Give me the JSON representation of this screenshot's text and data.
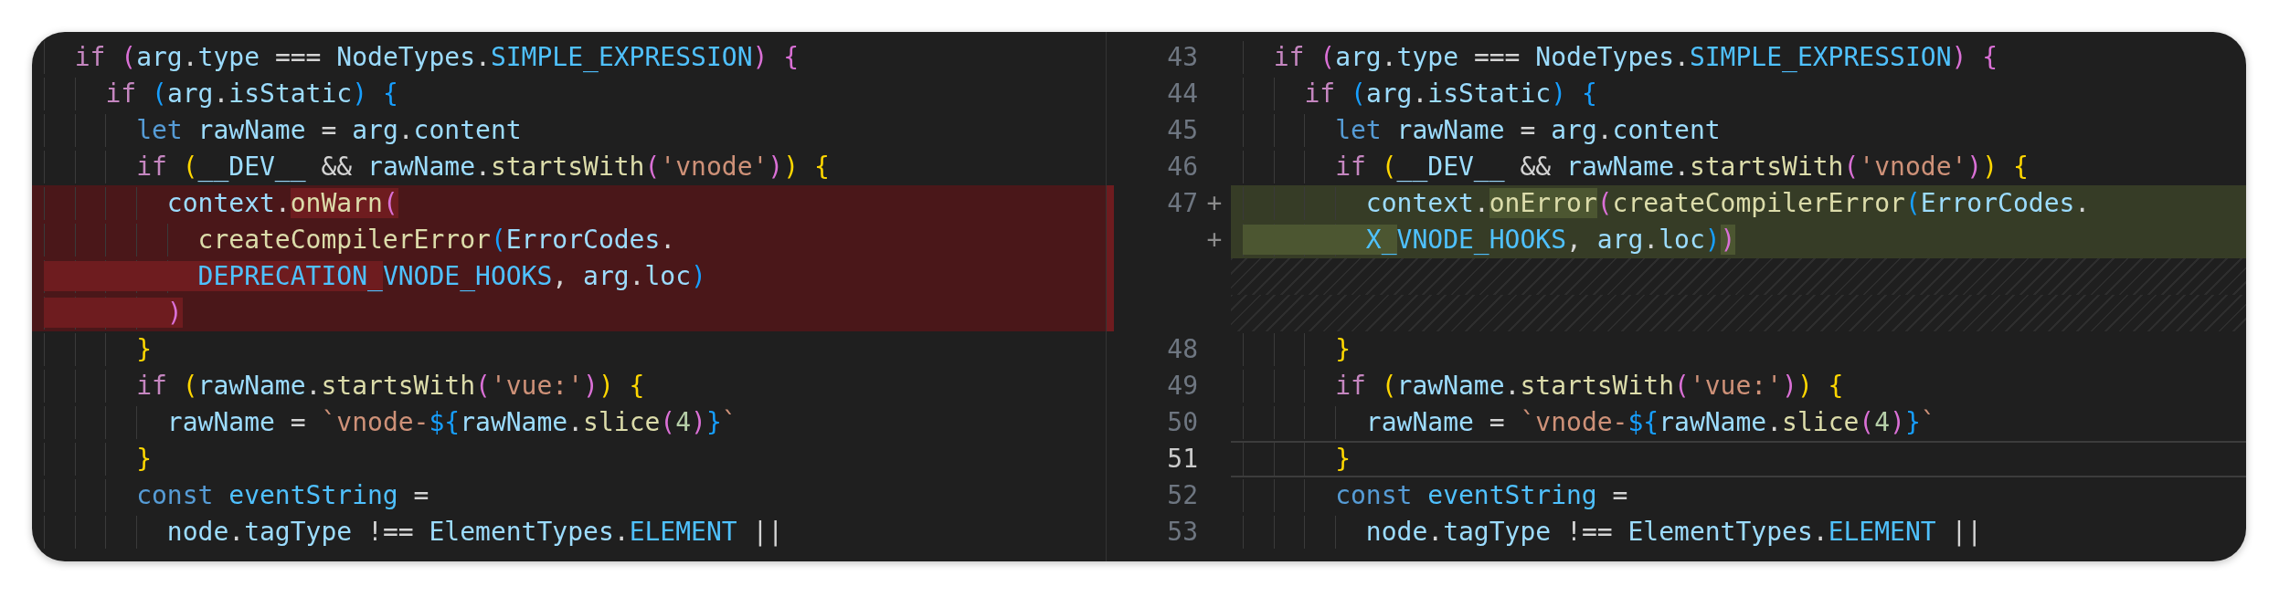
{
  "left": {
    "lines": [
      {
        "kind": "context",
        "tokens": [
          {
            "text": "  if ",
            "kind": "kw"
          },
          {
            "text": "(",
            "kind": "b2"
          },
          {
            "text": "arg",
            "kind": "var"
          },
          {
            "text": ".",
            "kind": "op"
          },
          {
            "text": "type",
            "kind": "var"
          },
          {
            "text": " === ",
            "kind": "op"
          },
          {
            "text": "NodeTypes",
            "kind": "var"
          },
          {
            "text": ".",
            "kind": "op"
          },
          {
            "text": "SIMPLE_EXPRESSION",
            "kind": "const"
          },
          {
            "text": ")",
            "kind": "b2"
          },
          {
            "text": " {",
            "kind": "b2"
          }
        ]
      },
      {
        "kind": "context",
        "tokens": [
          {
            "text": "    if ",
            "kind": "kw"
          },
          {
            "text": "(",
            "kind": "b3"
          },
          {
            "text": "arg",
            "kind": "var"
          },
          {
            "text": ".",
            "kind": "op"
          },
          {
            "text": "isStatic",
            "kind": "var"
          },
          {
            "text": ")",
            "kind": "b3"
          },
          {
            "text": " {",
            "kind": "b3"
          }
        ]
      },
      {
        "kind": "context",
        "tokens": [
          {
            "text": "      let ",
            "kind": "decl"
          },
          {
            "text": "rawName",
            "kind": "var"
          },
          {
            "text": " = ",
            "kind": "op"
          },
          {
            "text": "arg",
            "kind": "var"
          },
          {
            "text": ".",
            "kind": "op"
          },
          {
            "text": "content",
            "kind": "var"
          }
        ]
      },
      {
        "kind": "context",
        "tokens": [
          {
            "text": "      if ",
            "kind": "kw"
          },
          {
            "text": "(",
            "kind": "b1"
          },
          {
            "text": "__DEV__",
            "kind": "var"
          },
          {
            "text": " && ",
            "kind": "op"
          },
          {
            "text": "rawName",
            "kind": "var"
          },
          {
            "text": ".",
            "kind": "op"
          },
          {
            "text": "startsWith",
            "kind": "fn"
          },
          {
            "text": "(",
            "kind": "b2"
          },
          {
            "text": "'vnode'",
            "kind": "str"
          },
          {
            "text": ")",
            "kind": "b2"
          },
          {
            "text": ")",
            "kind": "b1"
          },
          {
            "text": " {",
            "kind": "b1"
          }
        ]
      },
      {
        "kind": "removed",
        "tokens": [
          {
            "text": "        context",
            "kind": "var",
            "changed": false
          },
          {
            "text": ".",
            "kind": "op",
            "changed": false
          },
          {
            "text": "onWarn",
            "kind": "fn",
            "changed": true
          },
          {
            "text": "(",
            "kind": "b2",
            "changed": true
          }
        ]
      },
      {
        "kind": "removed",
        "tokens": [
          {
            "text": "          createCompilerError",
            "kind": "fn",
            "changed": false
          },
          {
            "text": "(",
            "kind": "b3",
            "changed": false
          },
          {
            "text": "ErrorCodes",
            "kind": "var",
            "changed": false
          },
          {
            "text": ".",
            "kind": "op",
            "changed": false
          }
        ]
      },
      {
        "kind": "removed",
        "tokens": [
          {
            "text": "          DEPRECATION_",
            "kind": "const",
            "changed": true
          },
          {
            "text": "VNODE_HOOKS",
            "kind": "const",
            "changed": false
          },
          {
            "text": ", ",
            "kind": "op",
            "changed": false
          },
          {
            "text": "arg",
            "kind": "var",
            "changed": false
          },
          {
            "text": ".",
            "kind": "op",
            "changed": false
          },
          {
            "text": "loc",
            "kind": "var",
            "changed": false
          },
          {
            "text": ")",
            "kind": "b3",
            "changed": false
          }
        ]
      },
      {
        "kind": "removed",
        "tokens": [
          {
            "text": "        )",
            "kind": "b2",
            "changed": true
          }
        ]
      },
      {
        "kind": "context",
        "tokens": [
          {
            "text": "      }",
            "kind": "b1"
          }
        ]
      },
      {
        "kind": "context",
        "tokens": [
          {
            "text": "      if ",
            "kind": "kw"
          },
          {
            "text": "(",
            "kind": "b1"
          },
          {
            "text": "rawName",
            "kind": "var"
          },
          {
            "text": ".",
            "kind": "op"
          },
          {
            "text": "startsWith",
            "kind": "fn"
          },
          {
            "text": "(",
            "kind": "b2"
          },
          {
            "text": "'vue:'",
            "kind": "str"
          },
          {
            "text": ")",
            "kind": "b2"
          },
          {
            "text": ")",
            "kind": "b1"
          },
          {
            "text": " {",
            "kind": "b1"
          }
        ]
      },
      {
        "kind": "context",
        "tokens": [
          {
            "text": "        rawName",
            "kind": "var"
          },
          {
            "text": " = ",
            "kind": "op"
          },
          {
            "text": "`vnode-",
            "kind": "str"
          },
          {
            "text": "${",
            "kind": "b3"
          },
          {
            "text": "rawName",
            "kind": "var"
          },
          {
            "text": ".",
            "kind": "op"
          },
          {
            "text": "slice",
            "kind": "fn"
          },
          {
            "text": "(",
            "kind": "b2"
          },
          {
            "text": "4",
            "kind": "num"
          },
          {
            "text": ")",
            "kind": "b2"
          },
          {
            "text": "}",
            "kind": "b3"
          },
          {
            "text": "`",
            "kind": "str"
          }
        ]
      },
      {
        "kind": "context",
        "tokens": [
          {
            "text": "      }",
            "kind": "b1"
          }
        ]
      },
      {
        "kind": "context",
        "tokens": [
          {
            "text": "      const ",
            "kind": "decl"
          },
          {
            "text": "eventString",
            "kind": "const"
          },
          {
            "text": " =",
            "kind": "op"
          }
        ]
      },
      {
        "kind": "context",
        "tokens": [
          {
            "text": "        node",
            "kind": "var"
          },
          {
            "text": ".",
            "kind": "op"
          },
          {
            "text": "tagType",
            "kind": "var"
          },
          {
            "text": " !== ",
            "kind": "op"
          },
          {
            "text": "ElementTypes",
            "kind": "var"
          },
          {
            "text": ".",
            "kind": "op"
          },
          {
            "text": "ELEMENT",
            "kind": "const"
          },
          {
            "text": " ||",
            "kind": "op"
          }
        ]
      }
    ]
  },
  "right": {
    "lines": [
      {
        "kind": "context",
        "number": "43",
        "current": false,
        "tokens": [
          {
            "text": "  if ",
            "kind": "kw"
          },
          {
            "text": "(",
            "kind": "b2"
          },
          {
            "text": "arg",
            "kind": "var"
          },
          {
            "text": ".",
            "kind": "op"
          },
          {
            "text": "type",
            "kind": "var"
          },
          {
            "text": " === ",
            "kind": "op"
          },
          {
            "text": "NodeTypes",
            "kind": "var"
          },
          {
            "text": ".",
            "kind": "op"
          },
          {
            "text": "SIMPLE_EXPRESSION",
            "kind": "const"
          },
          {
            "text": ")",
            "kind": "b2"
          },
          {
            "text": " {",
            "kind": "b2"
          }
        ]
      },
      {
        "kind": "context",
        "number": "44",
        "current": false,
        "tokens": [
          {
            "text": "    if ",
            "kind": "kw"
          },
          {
            "text": "(",
            "kind": "b3"
          },
          {
            "text": "arg",
            "kind": "var"
          },
          {
            "text": ".",
            "kind": "op"
          },
          {
            "text": "isStatic",
            "kind": "var"
          },
          {
            "text": ")",
            "kind": "b3"
          },
          {
            "text": " {",
            "kind": "b3"
          }
        ]
      },
      {
        "kind": "context",
        "number": "45",
        "current": false,
        "tokens": [
          {
            "text": "      let ",
            "kind": "decl"
          },
          {
            "text": "rawName",
            "kind": "var"
          },
          {
            "text": " = ",
            "kind": "op"
          },
          {
            "text": "arg",
            "kind": "var"
          },
          {
            "text": ".",
            "kind": "op"
          },
          {
            "text": "content",
            "kind": "var"
          }
        ]
      },
      {
        "kind": "context",
        "number": "46",
        "current": false,
        "tokens": [
          {
            "text": "      if ",
            "kind": "kw"
          },
          {
            "text": "(",
            "kind": "b1"
          },
          {
            "text": "__DEV__",
            "kind": "var"
          },
          {
            "text": " && ",
            "kind": "op"
          },
          {
            "text": "rawName",
            "kind": "var"
          },
          {
            "text": ".",
            "kind": "op"
          },
          {
            "text": "startsWith",
            "kind": "fn"
          },
          {
            "text": "(",
            "kind": "b2"
          },
          {
            "text": "'vnode'",
            "kind": "str"
          },
          {
            "text": ")",
            "kind": "b2"
          },
          {
            "text": ")",
            "kind": "b1"
          },
          {
            "text": " {",
            "kind": "b1"
          }
        ]
      },
      {
        "kind": "added",
        "number": "47",
        "marker": "+",
        "current": false,
        "tokens": [
          {
            "text": "        context",
            "kind": "var",
            "changed": false
          },
          {
            "text": ".",
            "kind": "op",
            "changed": false
          },
          {
            "text": "onError",
            "kind": "fn",
            "changed": true
          },
          {
            "text": "(",
            "kind": "b2",
            "changed": false
          },
          {
            "text": "createCompilerError",
            "kind": "fn",
            "changed": false
          },
          {
            "text": "(",
            "kind": "b3",
            "changed": false
          },
          {
            "text": "ErrorCodes",
            "kind": "var",
            "changed": false
          },
          {
            "text": ".",
            "kind": "op",
            "changed": false
          }
        ]
      },
      {
        "kind": "added",
        "marker": "+",
        "current": false,
        "tokens": [
          {
            "text": "        X_",
            "kind": "const",
            "changed": true
          },
          {
            "text": "VNODE_HOOKS",
            "kind": "const",
            "changed": false
          },
          {
            "text": ", ",
            "kind": "op",
            "changed": false
          },
          {
            "text": "arg",
            "kind": "var",
            "changed": false
          },
          {
            "text": ".",
            "kind": "op",
            "changed": false
          },
          {
            "text": "loc",
            "kind": "var",
            "changed": false
          },
          {
            "text": ")",
            "kind": "b3",
            "changed": false
          },
          {
            "text": ")",
            "kind": "b2",
            "changed": true
          }
        ]
      },
      {
        "kind": "filler",
        "current": false
      },
      {
        "kind": "filler",
        "current": false
      },
      {
        "kind": "context",
        "number": "48",
        "current": false,
        "tokens": [
          {
            "text": "      }",
            "kind": "b1"
          }
        ]
      },
      {
        "kind": "context",
        "number": "49",
        "current": false,
        "tokens": [
          {
            "text": "      if ",
            "kind": "kw"
          },
          {
            "text": "(",
            "kind": "b1"
          },
          {
            "text": "rawName",
            "kind": "var"
          },
          {
            "text": ".",
            "kind": "op"
          },
          {
            "text": "startsWith",
            "kind": "fn"
          },
          {
            "text": "(",
            "kind": "b2"
          },
          {
            "text": "'vue:'",
            "kind": "str"
          },
          {
            "text": ")",
            "kind": "b2"
          },
          {
            "text": ")",
            "kind": "b1"
          },
          {
            "text": " {",
            "kind": "b1"
          }
        ]
      },
      {
        "kind": "context",
        "number": "50",
        "current": false,
        "tokens": [
          {
            "text": "        rawName",
            "kind": "var"
          },
          {
            "text": " = ",
            "kind": "op"
          },
          {
            "text": "`vnode-",
            "kind": "str"
          },
          {
            "text": "${",
            "kind": "b3"
          },
          {
            "text": "rawName",
            "kind": "var"
          },
          {
            "text": ".",
            "kind": "op"
          },
          {
            "text": "slice",
            "kind": "fn"
          },
          {
            "text": "(",
            "kind": "b2"
          },
          {
            "text": "4",
            "kind": "num"
          },
          {
            "text": ")",
            "kind": "b2"
          },
          {
            "text": "}",
            "kind": "b3"
          },
          {
            "text": "`",
            "kind": "str"
          }
        ]
      },
      {
        "kind": "context",
        "number": "51",
        "current": true,
        "tokens": [
          {
            "text": "      }",
            "kind": "b1"
          }
        ]
      },
      {
        "kind": "context",
        "number": "52",
        "current": false,
        "tokens": [
          {
            "text": "      const ",
            "kind": "decl"
          },
          {
            "text": "eventString",
            "kind": "const"
          },
          {
            "text": " =",
            "kind": "op"
          }
        ]
      },
      {
        "kind": "context",
        "number": "53",
        "current": false,
        "tokens": [
          {
            "text": "        node",
            "kind": "var"
          },
          {
            "text": ".",
            "kind": "op"
          },
          {
            "text": "tagType",
            "kind": "var"
          },
          {
            "text": " !== ",
            "kind": "op"
          },
          {
            "text": "ElementTypes",
            "kind": "var"
          },
          {
            "text": ".",
            "kind": "op"
          },
          {
            "text": "ELEMENT",
            "kind": "const"
          },
          {
            "text": " ||",
            "kind": "op"
          }
        ]
      }
    ]
  }
}
